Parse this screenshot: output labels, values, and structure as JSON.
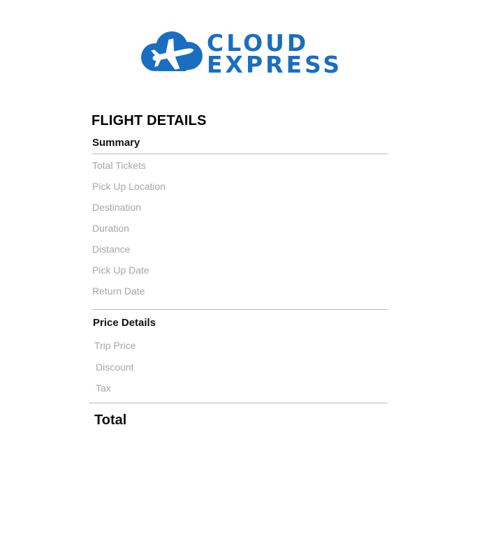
{
  "brand": {
    "name_line1": "CLOUD",
    "name_line2": "EXPRESS",
    "logo_icon": "cloud-airplane-icon",
    "color": "#1a6ec0"
  },
  "page_title": "FLIGHT DETAILS",
  "summary": {
    "title": "Summary",
    "rows": [
      "Total Tickets",
      "Pick Up Location",
      "Destination",
      "Duration",
      "Distance",
      "Pick Up Date",
      "Return Date"
    ]
  },
  "price_details": {
    "title": "Price Details",
    "rows": [
      "Trip Price",
      "Discount",
      "Tax"
    ]
  },
  "total": {
    "label": "Total"
  }
}
